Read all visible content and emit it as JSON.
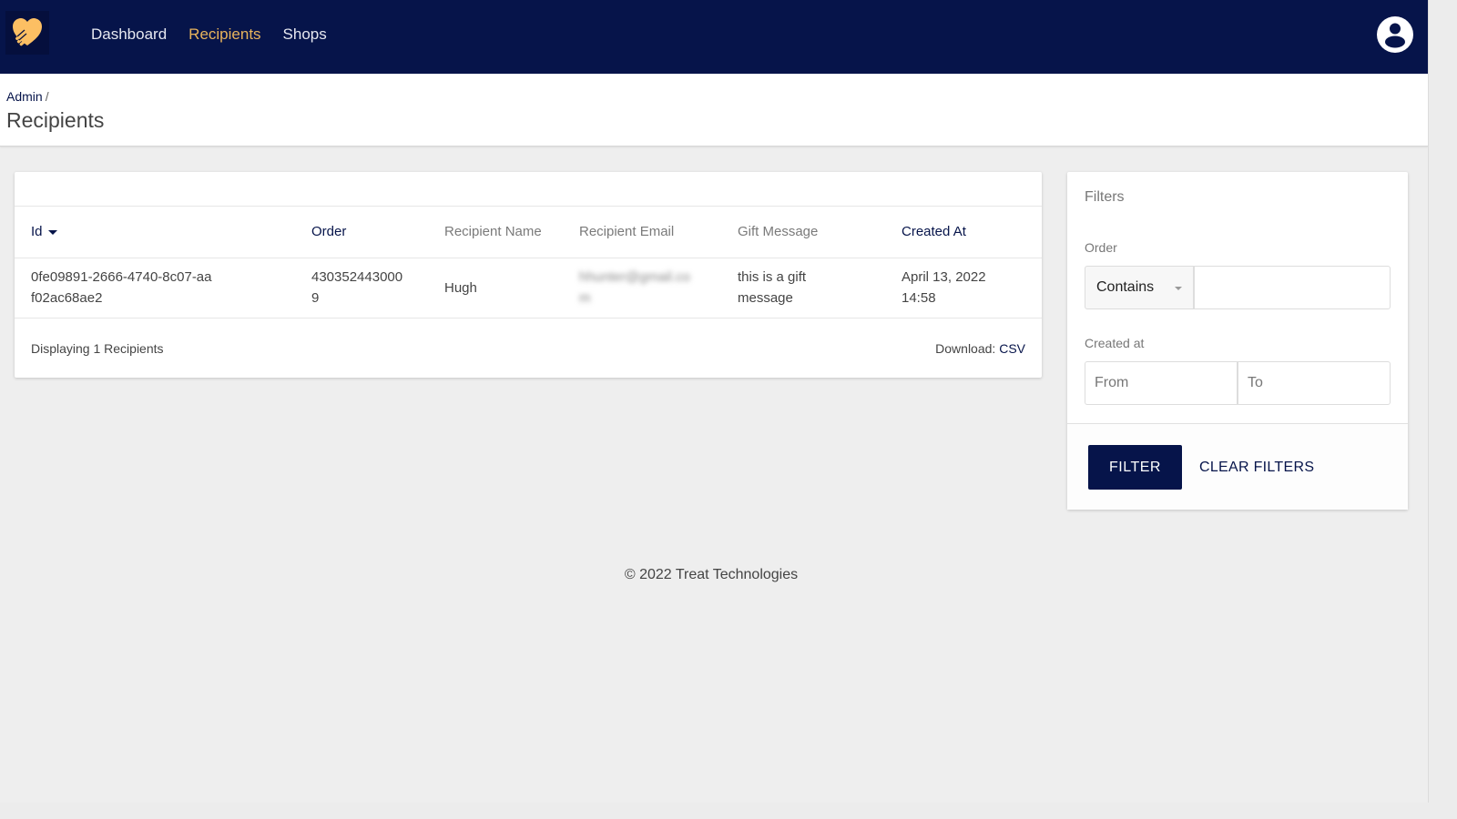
{
  "nav": {
    "links": [
      {
        "label": "Dashboard",
        "active": false
      },
      {
        "label": "Recipients",
        "active": true
      },
      {
        "label": "Shops",
        "active": false
      }
    ],
    "logo_icon": "heart-hand-icon",
    "user_icon": "account-circle-icon"
  },
  "header": {
    "breadcrumb": {
      "root": "Admin",
      "separator": "/"
    },
    "title": "Recipients"
  },
  "table": {
    "columns": [
      {
        "label": "Id",
        "sortable": true,
        "sorted": "desc"
      },
      {
        "label": "Order",
        "sortable": true
      },
      {
        "label": "Recipient Name",
        "sortable": false
      },
      {
        "label": "Recipient Email",
        "sortable": false
      },
      {
        "label": "Gift Message",
        "sortable": false
      },
      {
        "label": "Created At",
        "sortable": true
      }
    ],
    "rows": [
      {
        "id": "0fe09891-2666-4740-8c07-aaf02ac68ae2",
        "order": "4303524430009",
        "recipient_name": "Hugh",
        "recipient_email": "hhunter@gmail.com",
        "gift_message": "this is a gift message",
        "created_at": "April 13, 2022 14:58"
      }
    ],
    "footer": {
      "count_text": "Displaying 1 Recipients",
      "download_label": "Download:",
      "download_link": "CSV"
    }
  },
  "filters": {
    "title": "Filters",
    "order": {
      "label": "Order",
      "operator": "Contains",
      "value": ""
    },
    "created_at": {
      "label": "Created at",
      "from_placeholder": "From",
      "to_placeholder": "To"
    },
    "filter_button": "FILTER",
    "clear_button": "CLEAR FILTERS"
  },
  "footer": {
    "copyright": "© 2022 Treat Technologies"
  },
  "colors": {
    "nav_bg": "#06144a",
    "accent": "#e8b45c",
    "link": "#06144a",
    "page_bg": "#eeeeee"
  }
}
